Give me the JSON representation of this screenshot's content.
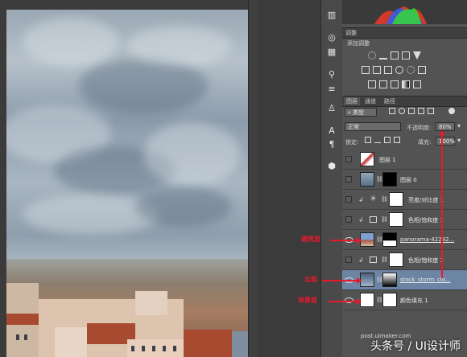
{
  "panel": {
    "adjust_header": "调整",
    "adjust_title": "添加调整",
    "layers_tabs": [
      "图层",
      "通道",
      "路径"
    ],
    "filter_kind": "类型",
    "blend_mode": "正常",
    "opacity_label": "不透明度:",
    "opacity_value": "80%",
    "lock_label": "锁定:",
    "fill_label": "填充:",
    "fill_value": "100%"
  },
  "layers": [
    {
      "name": "图层 1",
      "visible": false,
      "selected": false
    },
    {
      "name": "图层 0",
      "visible": false,
      "selected": false
    },
    {
      "name": "亮度/对比度 1",
      "visible": false,
      "selected": false
    },
    {
      "name": "色相/饱和度 1",
      "visible": false,
      "selected": false
    },
    {
      "name": "panorama-42292...",
      "visible": true,
      "selected": false
    },
    {
      "name": "色相/饱和度 2",
      "visible": false,
      "selected": false
    },
    {
      "name": "stock_storm_clo...",
      "visible": true,
      "selected": true
    },
    {
      "name": "颜色填充 1",
      "visible": true,
      "selected": false
    }
  ],
  "annotations": {
    "buildings": "建筑层",
    "clouds": "云层",
    "background": "背景层"
  },
  "watermark": "头条号 / UI设计师",
  "url": "post.uimaker.com",
  "colors": {
    "accent_red": "#e8192c",
    "selected_layer": "#6d85a4"
  }
}
